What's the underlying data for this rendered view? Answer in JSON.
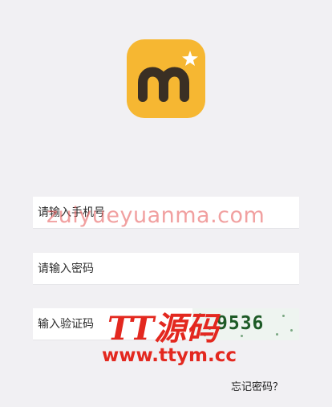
{
  "login": {
    "phone_placeholder": "请输入手机号",
    "password_placeholder": "请输入密码",
    "code_placeholder": "输入验证码",
    "captcha_text": "9536",
    "forgot_label": "忘记密码？"
  },
  "watermark": {
    "top_text": "zuiyueyuanma.com",
    "logo_text": "TT源码",
    "url_text": "www.ttym.cc"
  },
  "colors": {
    "background": "#f1f0f3",
    "logo_bg": "#f6b732",
    "logo_letter": "#3a2f24",
    "watermark_red": "#e3281f"
  },
  "icons": {
    "app_logo": "app-logo-m-with-star"
  }
}
